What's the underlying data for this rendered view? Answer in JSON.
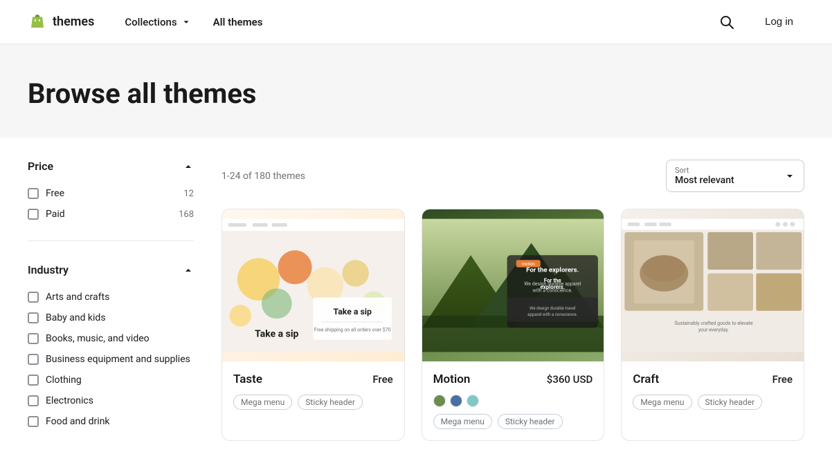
{
  "nav": {
    "logo_text": "themes",
    "collections_label": "Collections",
    "all_themes_label": "All themes",
    "login_label": "Log in"
  },
  "hero": {
    "title": "Browse all themes"
  },
  "results": {
    "count_text": "1-24 of 180 themes",
    "sort_label": "Sort",
    "sort_value": "Most relevant"
  },
  "sidebar": {
    "price_section": {
      "title": "Price",
      "items": [
        {
          "label": "Free",
          "count": "12"
        },
        {
          "label": "Paid",
          "count": "168"
        }
      ]
    },
    "industry_section": {
      "title": "Industry",
      "items": [
        {
          "label": "Arts and crafts"
        },
        {
          "label": "Baby and kids"
        },
        {
          "label": "Books, music, and video"
        },
        {
          "label": "Business equipment and supplies"
        },
        {
          "label": "Clothing"
        },
        {
          "label": "Electronics"
        },
        {
          "label": "Food and drink"
        }
      ]
    }
  },
  "themes": [
    {
      "name": "Taste",
      "price": "Free",
      "tags": [
        "Mega menu",
        "Sticky header"
      ],
      "swatches": [
        "#6b8c4e",
        "#4a6fa5",
        "#7ec8c8"
      ],
      "img_type": "taste"
    },
    {
      "name": "Motion",
      "price": "$360 USD",
      "tags": [
        "Mega menu",
        "Sticky header"
      ],
      "swatches": [
        "#6b8c4e",
        "#4a6fa5",
        "#7ec8c8"
      ],
      "img_type": "motion"
    },
    {
      "name": "Craft",
      "price": "Free",
      "tags": [
        "Mega menu",
        "Sticky header"
      ],
      "swatches": [],
      "img_type": "craft"
    }
  ],
  "icons": {
    "search": "🔍",
    "chevron_down": "▾",
    "chevron_up": "▴"
  }
}
